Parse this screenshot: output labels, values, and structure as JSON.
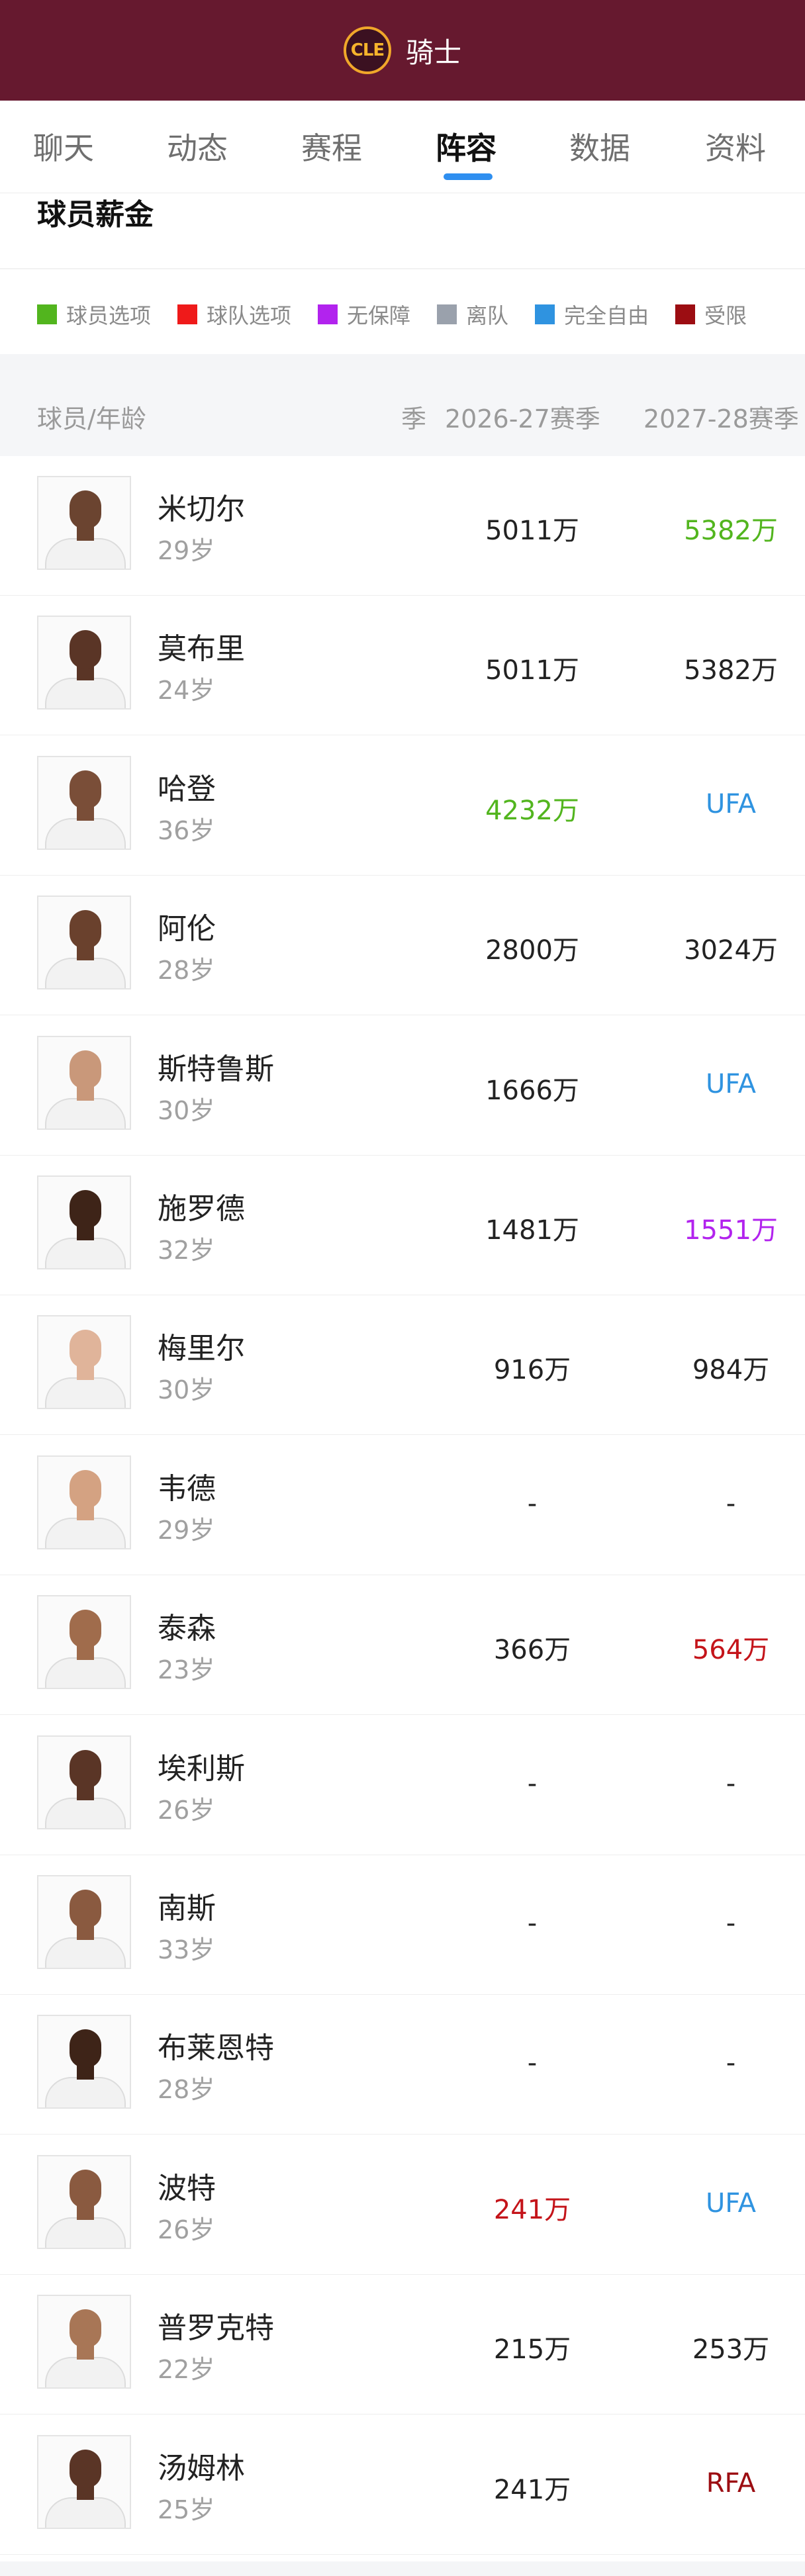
{
  "header": {
    "team_abbr": "CLE",
    "team_name": "骑士",
    "colors": {
      "bar": "#66192f",
      "logo_ring": "#f0a72a"
    }
  },
  "tabs": [
    {
      "label": "聊天",
      "active": false
    },
    {
      "label": "动态",
      "active": false
    },
    {
      "label": "赛程",
      "active": false
    },
    {
      "label": "阵容",
      "active": true
    },
    {
      "label": "数据",
      "active": false
    },
    {
      "label": "资料",
      "active": false
    }
  ],
  "section": {
    "title": "球员薪金"
  },
  "legend": [
    {
      "label": "球员选项",
      "color": "#52b51e"
    },
    {
      "label": "球队选项",
      "color": "#ef1a1a"
    },
    {
      "label": "无保障",
      "color": "#b223ee"
    },
    {
      "label": "离队",
      "color": "#9aa1ac"
    },
    {
      "label": "完全自由",
      "color": "#2f93e0"
    },
    {
      "label": "受限",
      "color": "#9c0d12"
    }
  ],
  "table": {
    "header": {
      "player": "球员/年龄",
      "prev_col_fragment": "季",
      "col1": "2026-27赛季",
      "col2": "2027-28赛季"
    },
    "rows": [
      {
        "name": "米切尔",
        "age": "29岁",
        "s1": "5011万",
        "s1_color": "#222222",
        "s2": "5382万",
        "s2_color": "#52b51e",
        "skin": "#6b4430"
      },
      {
        "name": "莫布里",
        "age": "24岁",
        "s1": "5011万",
        "s1_color": "#222222",
        "s2": "5382万",
        "s2_color": "#222222",
        "skin": "#5a3526"
      },
      {
        "name": "哈登",
        "age": "36岁",
        "s1": "4232万",
        "s1_color": "#52b51e",
        "s2": "UFA",
        "s2_color": "#2f93e0",
        "skin": "#7a4e38"
      },
      {
        "name": "阿伦",
        "age": "28岁",
        "s1": "2800万",
        "s1_color": "#222222",
        "s2": "3024万",
        "s2_color": "#222222",
        "skin": "#6a412d"
      },
      {
        "name": "斯特鲁斯",
        "age": "30岁",
        "s1": "1666万",
        "s1_color": "#222222",
        "s2": "UFA",
        "s2_color": "#2f93e0",
        "skin": "#c9987a"
      },
      {
        "name": "施罗德",
        "age": "32岁",
        "s1": "1481万",
        "s1_color": "#222222",
        "s2": "1551万",
        "s2_color": "#b223ee",
        "skin": "#3e2418"
      },
      {
        "name": "梅里尔",
        "age": "30岁",
        "s1": "916万",
        "s1_color": "#222222",
        "s2": "984万",
        "s2_color": "#222222",
        "skin": "#e0b49a"
      },
      {
        "name": "韦德",
        "age": "29岁",
        "s1": "-",
        "s1_color": "#222222",
        "s2": "-",
        "s2_color": "#222222",
        "skin": "#d4a282"
      },
      {
        "name": "泰森",
        "age": "23岁",
        "s1": "366万",
        "s1_color": "#222222",
        "s2": "564万",
        "s2_color": "#c4141a",
        "skin": "#a06c4c"
      },
      {
        "name": "埃利斯",
        "age": "26岁",
        "s1": "-",
        "s1_color": "#222222",
        "s2": "-",
        "s2_color": "#222222",
        "skin": "#5a3526"
      },
      {
        "name": "南斯",
        "age": "33岁",
        "s1": "-",
        "s1_color": "#222222",
        "s2": "-",
        "s2_color": "#222222",
        "skin": "#8a5a40"
      },
      {
        "name": "布莱恩特",
        "age": "28岁",
        "s1": "-",
        "s1_color": "#222222",
        "s2": "-",
        "s2_color": "#222222",
        "skin": "#3e2418"
      },
      {
        "name": "波特",
        "age": "26岁",
        "s1": "241万",
        "s1_color": "#c4141a",
        "s2": "UFA",
        "s2_color": "#2f93e0",
        "skin": "#8a5a40"
      },
      {
        "name": "普罗克特",
        "age": "22岁",
        "s1": "215万",
        "s1_color": "#222222",
        "s2": "253万",
        "s2_color": "#222222",
        "skin": "#a87656"
      },
      {
        "name": "汤姆林",
        "age": "25岁",
        "s1": "241万",
        "s1_color": "#222222",
        "s2": "RFA",
        "s2_color": "#9c0d12",
        "skin": "#5a3526"
      }
    ]
  }
}
